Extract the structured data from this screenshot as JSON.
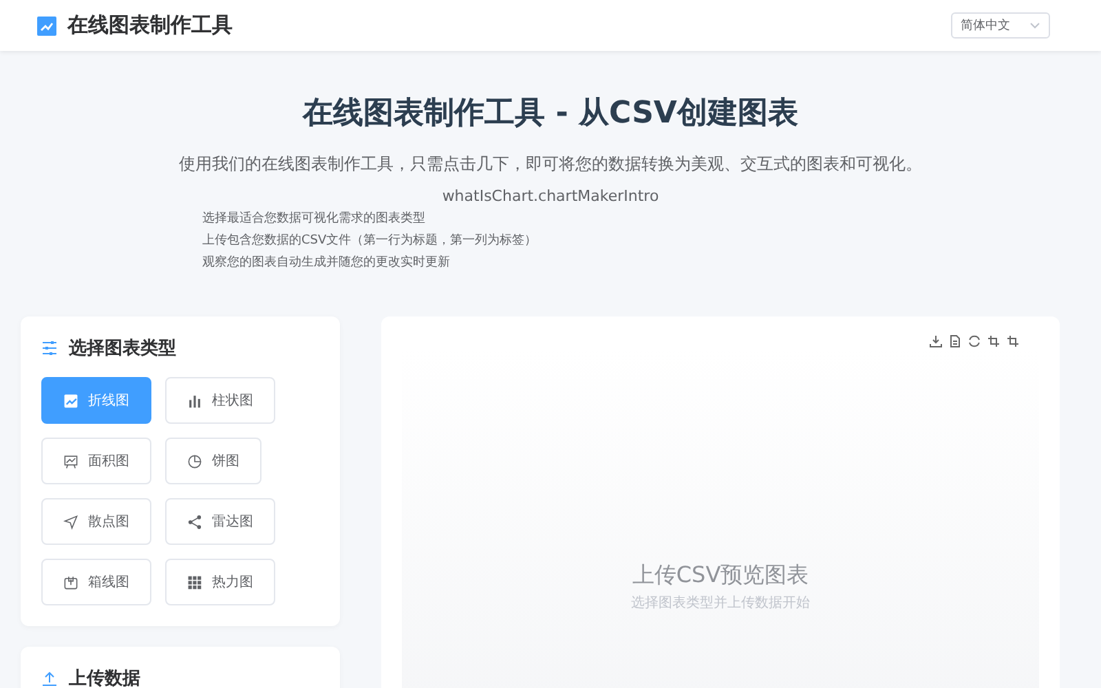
{
  "header": {
    "title": "在线图表制作工具",
    "language": "简体中文"
  },
  "hero": {
    "title": "在线图表制作工具 - 从CSV创建图表",
    "subtitle": "使用我们的在线图表制作工具，只需点击几下，即可将您的数据转换为美观、交互式的图表和可视化。",
    "intro": "whatIsChart.chartMakerIntro",
    "steps": [
      "选择最适合您数据可视化需求的图表类型",
      "上传包含您数据的CSV文件（第一行为标题，第一列为标签）",
      "观察您的图表自动生成并随您的更改实时更新"
    ]
  },
  "chart_types": {
    "title": "选择图表类型",
    "items": [
      {
        "label": "折线图",
        "kind": "line",
        "selected": true
      },
      {
        "label": "柱状图",
        "kind": "bar",
        "selected": false
      },
      {
        "label": "面积图",
        "kind": "area",
        "selected": false
      },
      {
        "label": "饼图",
        "kind": "pie",
        "selected": false
      },
      {
        "label": "散点图",
        "kind": "scatter",
        "selected": false
      },
      {
        "label": "雷达图",
        "kind": "radar",
        "selected": false
      },
      {
        "label": "箱线图",
        "kind": "box",
        "selected": false
      },
      {
        "label": "热力图",
        "kind": "heatmap",
        "selected": false
      }
    ]
  },
  "upload": {
    "title": "上传数据"
  },
  "preview": {
    "title": "上传CSV预览图表",
    "hint": "选择图表类型并上传数据开始"
  }
}
